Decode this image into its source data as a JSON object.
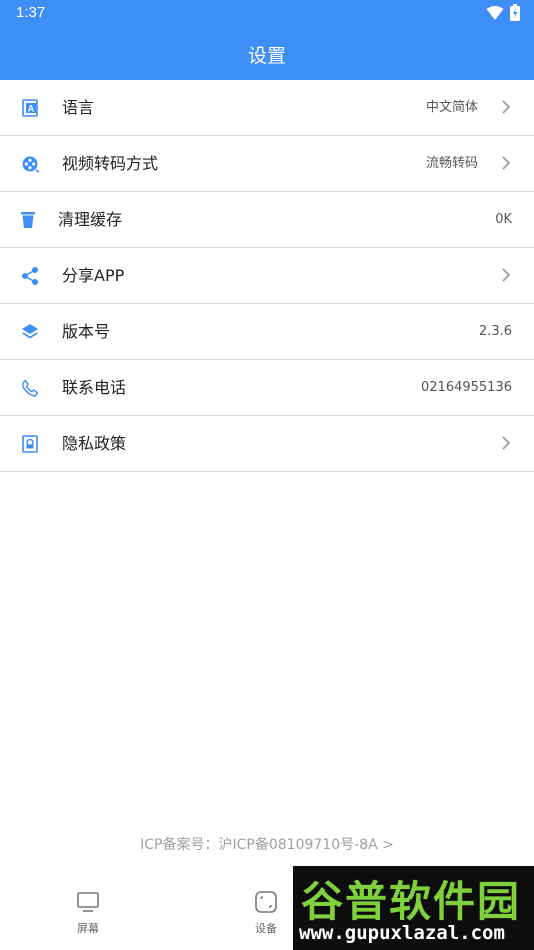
{
  "status_bar": {
    "time": "1:37",
    "icons": [
      "wifi-icon",
      "battery-icon"
    ]
  },
  "header": {
    "title": "设置",
    "background": "#3e8ef7"
  },
  "settings": [
    {
      "icon": "language-icon",
      "label": "语言",
      "value": "中文简体",
      "arrow": true
    },
    {
      "icon": "video-reel-icon",
      "label": "视频转码方式",
      "value": "流畅转码",
      "arrow": true
    },
    {
      "icon": "trash-icon",
      "label": "清理缓存",
      "value": "0K",
      "arrow": false
    },
    {
      "icon": "share-icon",
      "label": "分享APP",
      "value": "",
      "arrow": true
    },
    {
      "icon": "layers-icon",
      "label": "版本号",
      "value": "2.3.6",
      "arrow": false
    },
    {
      "icon": "phone-icon",
      "label": "联系电话",
      "value": "02164955136",
      "arrow": false
    },
    {
      "icon": "privacy-icon",
      "label": "隐私政策",
      "value": "",
      "arrow": true
    }
  ],
  "footer": {
    "icp": "ICP备案号：沪ICP备08109710号-8A >"
  },
  "bottom_nav": [
    {
      "icon": "monitor-icon",
      "label": "屏幕"
    },
    {
      "icon": "device-icon",
      "label": "设备"
    }
  ],
  "watermark": {
    "title": "谷普软件园",
    "url": "www.gupuxlazal.com"
  }
}
